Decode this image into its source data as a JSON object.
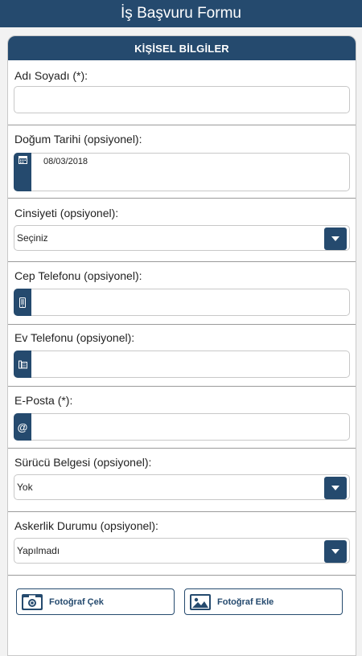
{
  "app": {
    "title": "İş Başvuru Formu"
  },
  "section": {
    "title": "KİŞİSEL BİLGİLER"
  },
  "fields": {
    "name": {
      "label": "Adı Soyadı (*):",
      "value": ""
    },
    "birth_date": {
      "label": "Doğum Tarihi (opsiyonel):",
      "value": "08/03/2018",
      "icon": "calendar-icon"
    },
    "gender": {
      "label": "Cinsiyeti (opsiyonel):",
      "value": "Seçiniz"
    },
    "mobile_phone": {
      "label": "Cep Telefonu (opsiyonel):",
      "value": "",
      "icon": "mobile-phone-icon"
    },
    "home_phone": {
      "label": "Ev Telefonu (opsiyonel):",
      "value": "",
      "icon": "landline-phone-icon"
    },
    "email": {
      "label": "E-Posta (*):",
      "value": "",
      "icon_glyph": "@"
    },
    "driver_license": {
      "label": "Sürücü Belgesi (opsiyonel):",
      "value": "Yok"
    },
    "military": {
      "label": "Askerlik Durumu (opsiyonel):",
      "value": "Yapılmadı"
    }
  },
  "buttons": {
    "take_photo": "Fotoğraf Çek",
    "add_photo": "Fotoğraf Ekle"
  },
  "colors": {
    "primary": "#254a6e",
    "border": "#c8c8c8",
    "background": "#f2f2f2"
  }
}
